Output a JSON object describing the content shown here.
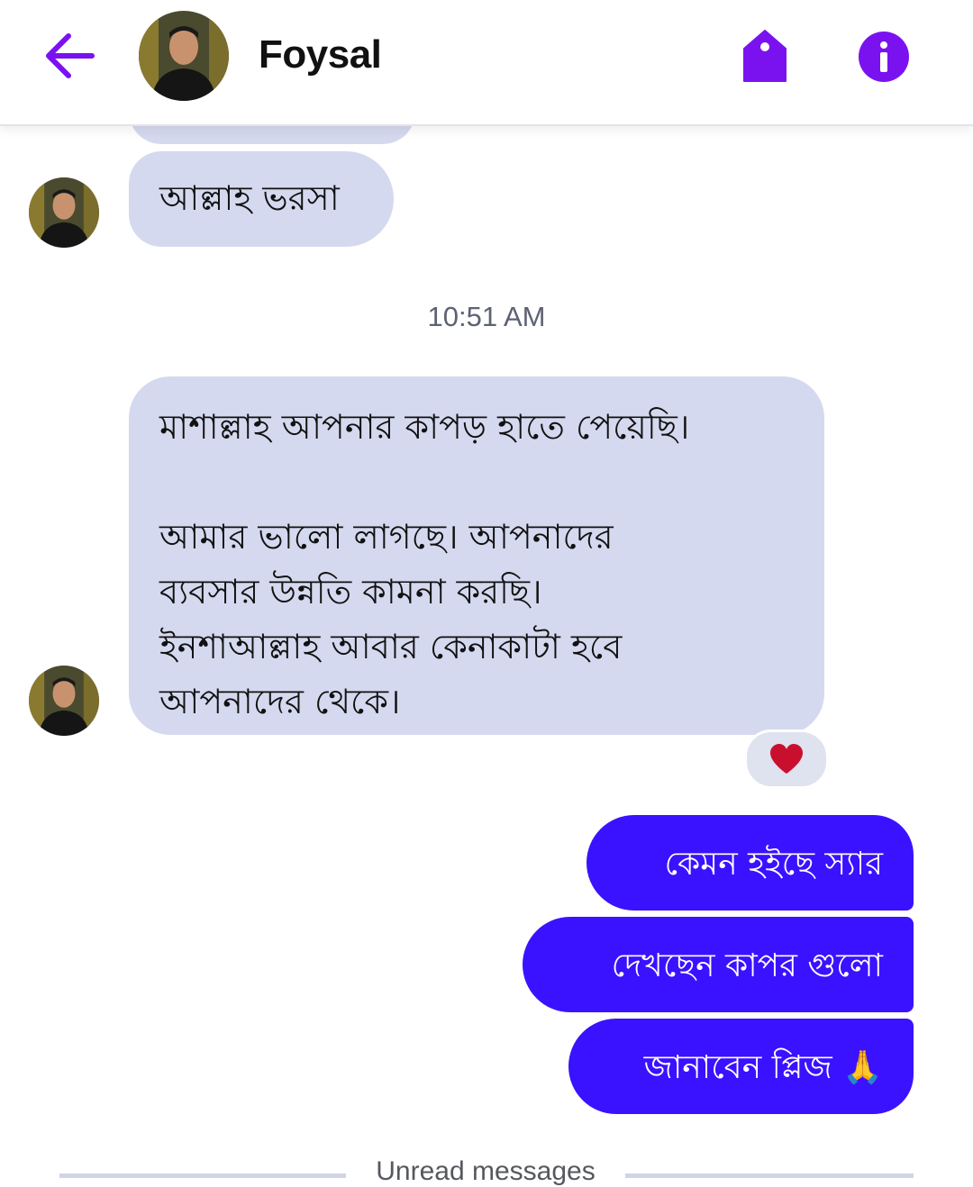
{
  "header": {
    "contact_name": "Foysal",
    "back_icon": "arrow-left-icon",
    "tag_icon": "tag-icon",
    "info_icon": "info-icon",
    "accent_color": "#7a12f0"
  },
  "messages": {
    "partial_previous": "",
    "incoming_1": "আল্লাহ ভরসা",
    "timestamp": "10:51 AM",
    "incoming_2": "মাশাল্লাহ আপনার কাপড় হাতে পেয়েছি।\n\nআমার ভালো লাগছে। আপনাদের\nব্যবসার উন্নতি কামনা করছি।\nইনশাআল্লাহ আবার কেনাকাটা হবে\nআপনাদের থেকে।",
    "incoming_2_reaction": "❤",
    "outgoing": [
      "কেমন হইছে স্যার",
      "দেখছেন কাপর গুলো",
      "জানাবেন প্লিজ 🙏"
    ]
  },
  "divider": {
    "unread_label": "Unread messages"
  },
  "colors": {
    "incoming_bubble": "#d5d9ef",
    "outgoing_bubble": "#3a12ff",
    "reaction_heart": "#c8102e"
  }
}
